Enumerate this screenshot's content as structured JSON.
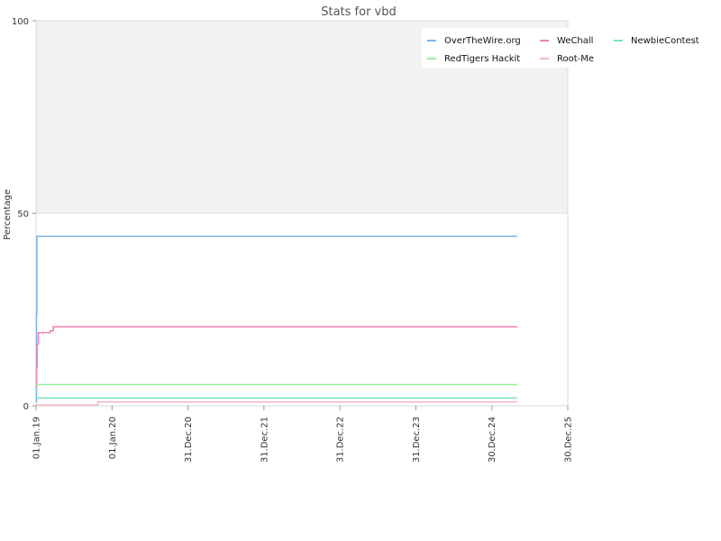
{
  "chart_data": {
    "type": "line",
    "title": "Stats for vbd",
    "ylabel": "Percentage",
    "xlabel": "",
    "ylim": [
      0,
      100
    ],
    "yticks": [
      0,
      50,
      100
    ],
    "xlim": [
      "2019-01-01",
      "2025-12-30"
    ],
    "xticks": [
      {
        "date": "2019-01-01",
        "label": "01.Jan.19"
      },
      {
        "date": "2020-01-01",
        "label": "01.Jan.20"
      },
      {
        "date": "2020-12-31",
        "label": "31.Dec.20"
      },
      {
        "date": "2021-12-31",
        "label": "31.Dec.21"
      },
      {
        "date": "2022-12-31",
        "label": "31.Dec.22"
      },
      {
        "date": "2023-12-31",
        "label": "31.Dec.23"
      },
      {
        "date": "2024-12-30",
        "label": "30.Dec.24"
      },
      {
        "date": "2025-12-30",
        "label": "30.Dec.25"
      }
    ],
    "grid": false,
    "background_bands": [
      {
        "from": 50,
        "to": 100,
        "color": "#f2f2f2"
      },
      {
        "from": 0,
        "to": 50,
        "color": "#ffffff"
      }
    ],
    "legend": {
      "position": "top-right"
    },
    "series": [
      {
        "name": "OverTheWire.org",
        "color": "#7fb5e6",
        "points": [
          [
            "2019-01-01",
            1
          ],
          [
            "2019-01-03",
            24
          ],
          [
            "2019-01-05",
            44
          ],
          [
            "2025-05-01",
            44
          ]
        ]
      },
      {
        "name": "WeChall",
        "color": "#ee82b4",
        "points": [
          [
            "2019-01-01",
            5
          ],
          [
            "2019-01-03",
            10
          ],
          [
            "2019-01-06",
            16
          ],
          [
            "2019-01-12",
            19
          ],
          [
            "2019-03-10",
            19.5
          ],
          [
            "2019-03-25",
            20.5
          ],
          [
            "2025-05-01",
            20.5
          ]
        ]
      },
      {
        "name": "NewbieContest",
        "color": "#7ee0c4",
        "points": [
          [
            "2019-01-01",
            2
          ],
          [
            "2025-05-01",
            2
          ]
        ]
      },
      {
        "name": "RedTigers Hackit",
        "color": "#99ee99",
        "points": [
          [
            "2019-01-01",
            5.5
          ],
          [
            "2025-05-01",
            5.5
          ]
        ]
      },
      {
        "name": "Root-Me",
        "color": "#f0b6c8",
        "points": [
          [
            "2019-01-01",
            0.2
          ],
          [
            "2019-10-20",
            0.2
          ],
          [
            "2019-10-25",
            1
          ],
          [
            "2025-05-01",
            1
          ]
        ]
      }
    ]
  }
}
